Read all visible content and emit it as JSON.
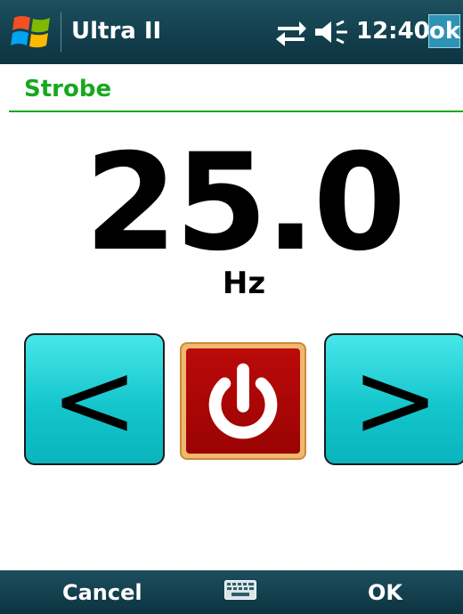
{
  "titlebar": {
    "app_title": "Ultra II",
    "clock": "12:40",
    "ok_label": "ok",
    "icons": [
      "windows-start-icon",
      "data-sync-icon",
      "speaker-icon"
    ]
  },
  "page": {
    "title": "Strobe"
  },
  "readout": {
    "value": "25.0",
    "unit": "Hz"
  },
  "controls": {
    "decrease_label": "<",
    "increase_label": ">",
    "power_icon": "power-icon"
  },
  "softkeys": {
    "left_label": "Cancel",
    "right_label": "OK",
    "center_icon": "keyboard-icon"
  },
  "colors": {
    "accent_green": "#17a81d",
    "button_cyan": "#14c6cc",
    "power_red": "#a80505",
    "power_frame": "#f1b86e",
    "bar_dark": "#14414f"
  }
}
